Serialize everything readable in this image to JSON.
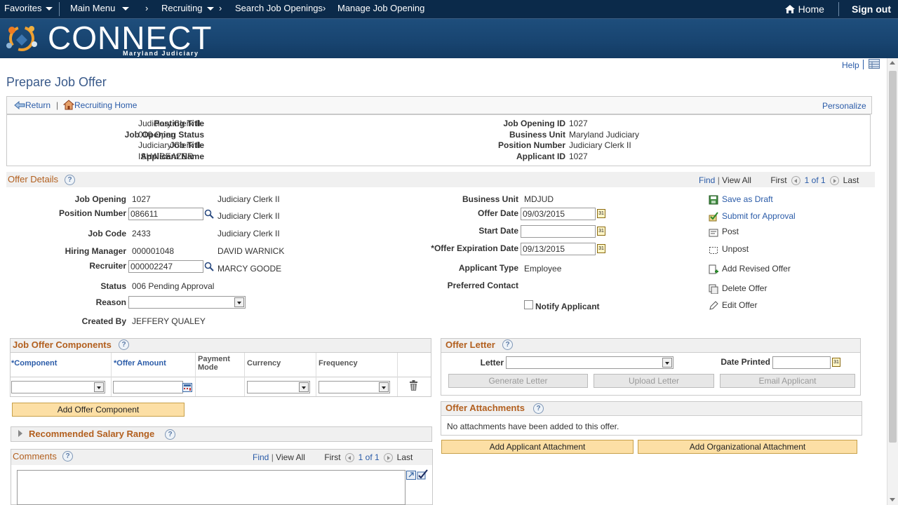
{
  "topnav": {
    "favorites": "Favorites",
    "main_menu": "Main Menu",
    "breadcrumbs": [
      "Recruiting",
      "Search Job Openings",
      "Manage Job Opening"
    ],
    "home": "Home",
    "sign_out": "Sign out"
  },
  "banner": {
    "logo": "CONNECT",
    "sub": "Maryland Judiciary"
  },
  "page": {
    "title": "Prepare Job Offer",
    "help": "Help",
    "personalize": "Personalize",
    "return": "Return",
    "recruiting_home": "Recruiting Home"
  },
  "summary": {
    "posting_title_l": "Posting Title",
    "posting_title": "Judiciary Clerk II",
    "job_opening_status_l": "Job Opening Status",
    "job_opening_status": "010 Open",
    "job_title_l": "Job Title",
    "job_title": "Judiciary Clerk II",
    "applicant_name_l": "Applicant Name",
    "applicant_name": "ISHA BEAZER",
    "job_opening_id_l": "Job Opening ID",
    "job_opening_id": "1027",
    "business_unit_l": "Business Unit",
    "business_unit": "Maryland Judiciary",
    "position_number_l": "Position Number",
    "position_number": "Judiciary Clerk II",
    "applicant_id_l": "Applicant ID",
    "applicant_id": "1027"
  },
  "offer": {
    "section": "Offer Details",
    "find": "Find",
    "view_all": "View All",
    "first": "First",
    "count": "1 of 1",
    "last": "Last",
    "job_opening_l": "Job Opening",
    "job_opening": "1027",
    "job_opening_desc": "Judiciary Clerk II",
    "position_number_l": "Position Number",
    "position_number": "086611",
    "position_desc": "Judiciary Clerk II",
    "job_code_l": "Job Code",
    "job_code": "2433",
    "job_code_desc": "Judiciary Clerk II",
    "hiring_manager_l": "Hiring Manager",
    "hiring_manager": "000001048",
    "hiring_manager_name": "DAVID WARNICK",
    "recruiter_l": "Recruiter",
    "recruiter": "000002247",
    "recruiter_name": "MARCY GOODE",
    "status_l": "Status",
    "status": "006 Pending Approval",
    "reason_l": "Reason",
    "created_by_l": "Created By",
    "created_by": "JEFFERY QUALEY",
    "business_unit_l": "Business Unit",
    "business_unit": "MDJUD",
    "offer_date_l": "Offer Date",
    "offer_date": "09/03/2015",
    "start_date_l": "Start Date",
    "start_date": "",
    "expiration_l": "*Offer Expiration Date",
    "expiration": "09/13/2015",
    "applicant_type_l": "Applicant Type",
    "applicant_type": "Employee",
    "preferred_contact_l": "Preferred Contact",
    "notify_applicant": "Notify Applicant"
  },
  "actions": {
    "save_draft": "Save as Draft",
    "submit": "Submit for Approval",
    "post": "Post",
    "unpost": "Unpost",
    "add_revised": "Add Revised Offer",
    "delete": "Delete Offer",
    "edit": "Edit Offer"
  },
  "components": {
    "section": "Job Offer Components",
    "columns": [
      "*Component",
      "*Offer Amount",
      "Payment Mode",
      "Currency",
      "Frequency"
    ],
    "add_button": "Add Offer Component"
  },
  "salary": {
    "section": "Recommended Salary Range"
  },
  "comments": {
    "section": "Comments",
    "find": "Find",
    "view_all": "View All",
    "first": "First",
    "count": "1 of 1",
    "last": "Last"
  },
  "letter": {
    "section": "Offer Letter",
    "letter_l": "Letter",
    "date_printed_l": "Date Printed",
    "generate": "Generate Letter",
    "upload": "Upload Letter",
    "email": "Email Applicant"
  },
  "attachments": {
    "section": "Offer Attachments",
    "empty": "No attachments have been added to this offer.",
    "add_applicant": "Add Applicant Attachment",
    "add_org": "Add Organizational Attachment"
  }
}
